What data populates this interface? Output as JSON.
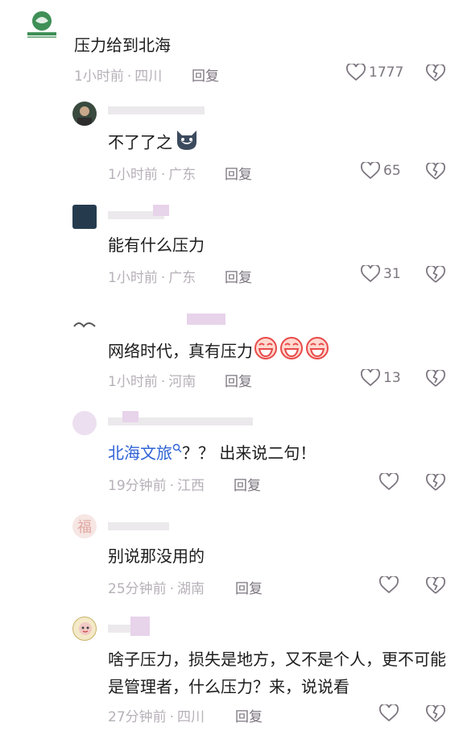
{
  "op": {
    "text": "压力给到北海",
    "time": "1小时前",
    "location": "四川",
    "reply_label": "回复",
    "likes": "1777"
  },
  "comments": [
    {
      "text": "不了了之",
      "time": "1小时前",
      "location": "广东",
      "reply_label": "回复",
      "likes": "65"
    },
    {
      "text": "能有什么压力",
      "time": "1小时前",
      "location": "广东",
      "reply_label": "回复",
      "likes": "31"
    },
    {
      "text": "网络时代，真有压力",
      "time": "1小时前",
      "location": "河南",
      "reply_label": "回复",
      "likes": "13"
    },
    {
      "text_link": "北海文旅",
      "text_rest": "？？ 出来说二句！",
      "time": "19分钟前",
      "location": "江西",
      "reply_label": "回复",
      "likes": ""
    },
    {
      "text": "别说那没用的",
      "time": "25分钟前",
      "location": "湖南",
      "reply_label": "回复",
      "likes": ""
    },
    {
      "text": "啥子压力，损失是地方，又不是个人，更不可能是管理者，什么压力？来，说说看",
      "time": "27分钟前",
      "location": "四川",
      "reply_label": "回复",
      "likes": ""
    }
  ],
  "usernames": [
    "",
    "",
    "",
    "",
    "",
    ""
  ],
  "colors": {
    "link": "#2f63d6",
    "meta": "#b7b0b9",
    "action": "#7c757f",
    "blur": "#e7d3ea"
  }
}
